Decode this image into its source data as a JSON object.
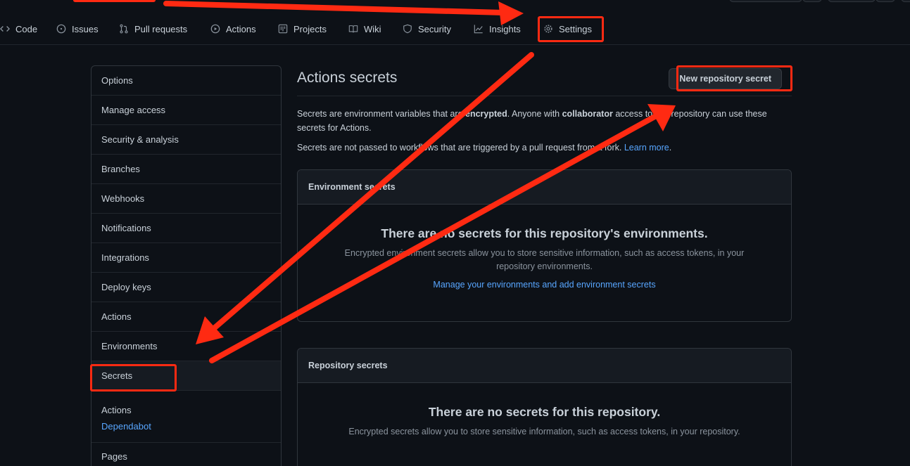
{
  "repo_nav": {
    "tabs": [
      {
        "label": "Code",
        "icon": "code-icon"
      },
      {
        "label": "Issues",
        "icon": "issue-icon"
      },
      {
        "label": "Pull requests",
        "icon": "pull-request-icon"
      },
      {
        "label": "Actions",
        "icon": "play-icon"
      },
      {
        "label": "Projects",
        "icon": "project-icon"
      },
      {
        "label": "Wiki",
        "icon": "book-icon"
      },
      {
        "label": "Security",
        "icon": "shield-icon"
      },
      {
        "label": "Insights",
        "icon": "graph-icon"
      },
      {
        "label": "Settings",
        "icon": "gear-icon"
      }
    ]
  },
  "sidebar": {
    "items": [
      "Options",
      "Manage access",
      "Security & analysis",
      "Branches",
      "Webhooks",
      "Notifications",
      "Integrations",
      "Deploy keys",
      "Actions",
      "Environments",
      "Secrets"
    ],
    "sub_items": [
      "Actions",
      "Dependabot"
    ],
    "after_items": [
      "Pages"
    ]
  },
  "main": {
    "title": "Actions secrets",
    "new_button": "New repository secret",
    "desc_part1": "Secrets are environment variables that are ",
    "desc_bold1": "encrypted",
    "desc_part2": ". Anyone with ",
    "desc_bold2": "collaborator",
    "desc_part3": " access to this repository can use these secrets for Actions.",
    "desc2_text": "Secrets are not passed to workflows that are triggered by a pull request from a fork. ",
    "learn_more": "Learn more",
    "desc2_end": ".",
    "env_box": {
      "header": "Environment secrets",
      "title": "There are no secrets for this repository's environments.",
      "desc": "Encrypted environment secrets allow you to store sensitive information, such as access tokens, in your repository environments.",
      "link": "Manage your environments and add environment secrets"
    },
    "repo_box": {
      "header": "Repository secrets",
      "title": "There are no secrets for this repository.",
      "desc": "Encrypted secrets allow you to store sensitive information, such as access tokens, in your repository."
    }
  },
  "colors": {
    "background": "#0d1117",
    "border": "#30363d",
    "link": "#58a6ff",
    "annotation": "#ff2a12"
  }
}
